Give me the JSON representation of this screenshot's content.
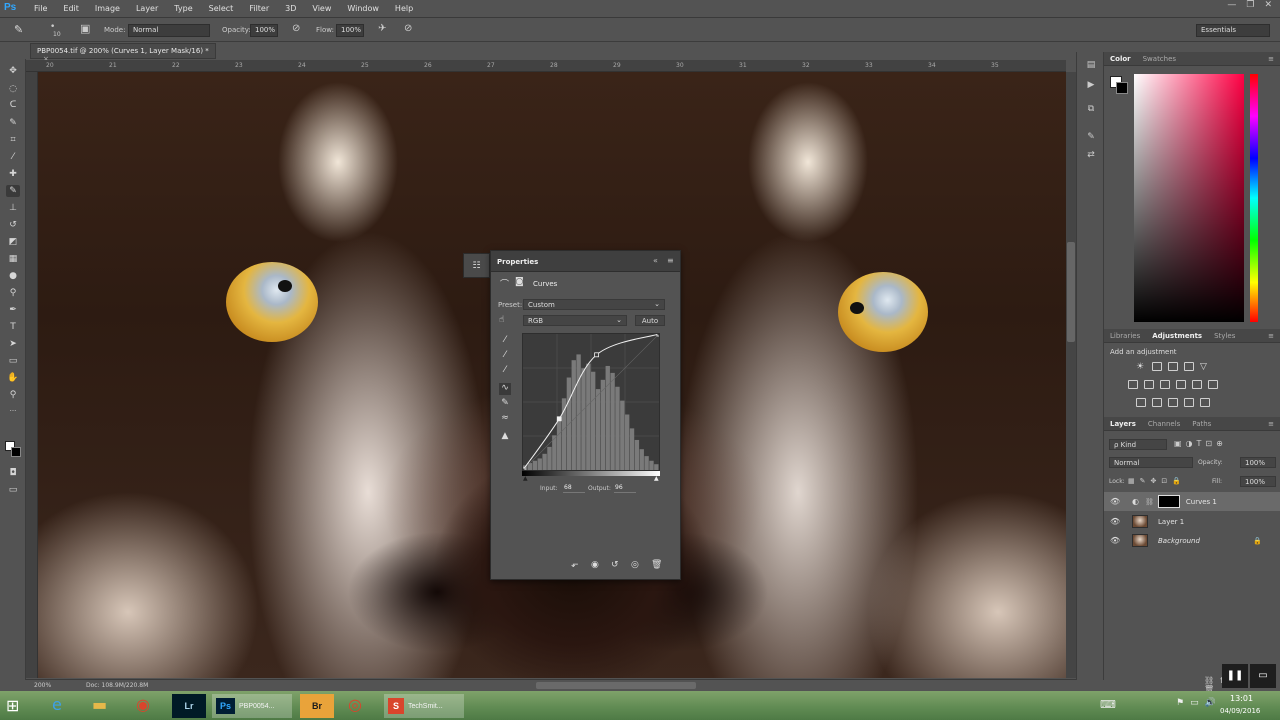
{
  "app": {
    "logo": "Ps",
    "menu": [
      "File",
      "Edit",
      "Image",
      "Layer",
      "Type",
      "Select",
      "Filter",
      "3D",
      "View",
      "Window",
      "Help"
    ],
    "window_controls": [
      "—",
      "❐",
      "✕"
    ]
  },
  "options_bar": {
    "brush_size": "10",
    "mode_label": "Mode:",
    "mode_value": "Normal",
    "opacity_label": "Opacity:",
    "opacity_value": "100%",
    "flow_label": "Flow:",
    "flow_value": "100%",
    "workspace": "Essentials"
  },
  "document_tab": {
    "title": "PBP0054.tif @ 200% (Curves 1, Layer Mask/16) *",
    "close": "×"
  },
  "ruler_top_labels": [
    "20",
    "21",
    "22",
    "23",
    "24",
    "25",
    "26",
    "27",
    "28",
    "29",
    "30",
    "31",
    "32",
    "33",
    "34",
    "35"
  ],
  "properties": {
    "title": "Properties",
    "collapse": "«",
    "menu": "≡",
    "adjustment_name": "Curves",
    "preset_label": "Preset:",
    "preset_value": "Custom",
    "channel_value": "RGB",
    "auto_button": "Auto",
    "input_label": "Input:",
    "input_value": "68",
    "output_label": "Output:",
    "output_value": "96"
  },
  "color_panel": {
    "tabs": [
      "Color",
      "Swatches"
    ],
    "menu": "≡"
  },
  "adjustments_panel": {
    "tabs": [
      "Libraries",
      "Adjustments",
      "Styles"
    ],
    "add_label": "Add an adjustment",
    "menu": "≡"
  },
  "layers_panel": {
    "tabs": [
      "Layers",
      "Channels",
      "Paths"
    ],
    "menu": "≡",
    "filter_kind": "ρ Kind",
    "blend_mode": "Normal",
    "opacity_label": "Opacity:",
    "opacity_value": "100%",
    "lock_label": "Lock:",
    "fill_label": "Fill:",
    "fill_value": "100%",
    "layers": [
      {
        "name": "Curves 1",
        "selected": true
      },
      {
        "name": "Layer 1",
        "selected": false
      },
      {
        "name": "Background",
        "selected": false,
        "locked": true
      }
    ]
  },
  "status_bar": {
    "zoom": "200%",
    "doc_info": "Doc: 108.9M/220.8M"
  },
  "taskbar": {
    "apps": [
      {
        "label": "Ps",
        "title": "PBP0054...",
        "color": "#31a8ff",
        "bg": "#001d34"
      },
      {
        "label": "Lr",
        "title": "",
        "color": "#add5ec",
        "bg": "#001a26"
      },
      {
        "label": "Br",
        "title": "",
        "color": "#1b1b1b",
        "bg": "#e9a33a"
      },
      {
        "label": "TechSmit...",
        "title": "TechSmit...",
        "color": "#ffffff",
        "bg": "#d9452c"
      }
    ],
    "time": "13:01",
    "date": "04/09/2016"
  },
  "colors": {
    "accent": "#31a8ff",
    "panel_bg": "#535353",
    "panel_dark": "#3f3f3f",
    "selected_layer": "#6a6a6a"
  },
  "chart_data": {
    "type": "line",
    "title": "",
    "xlabel": "Input",
    "ylabel": "Output",
    "xlim": [
      0,
      255
    ],
    "ylim": [
      0,
      255
    ],
    "series": [
      {
        "values": [
          [
            0,
            0
          ],
          [
            68,
            96
          ],
          [
            138,
            216
          ],
          [
            255,
            255
          ]
        ]
      }
    ],
    "histogram": [
      4,
      6,
      8,
      10,
      14,
      20,
      30,
      45,
      62,
      80,
      95,
      100,
      88,
      92,
      85,
      70,
      78,
      90,
      84,
      72,
      60,
      48,
      36,
      26,
      18,
      12,
      8,
      5
    ]
  }
}
